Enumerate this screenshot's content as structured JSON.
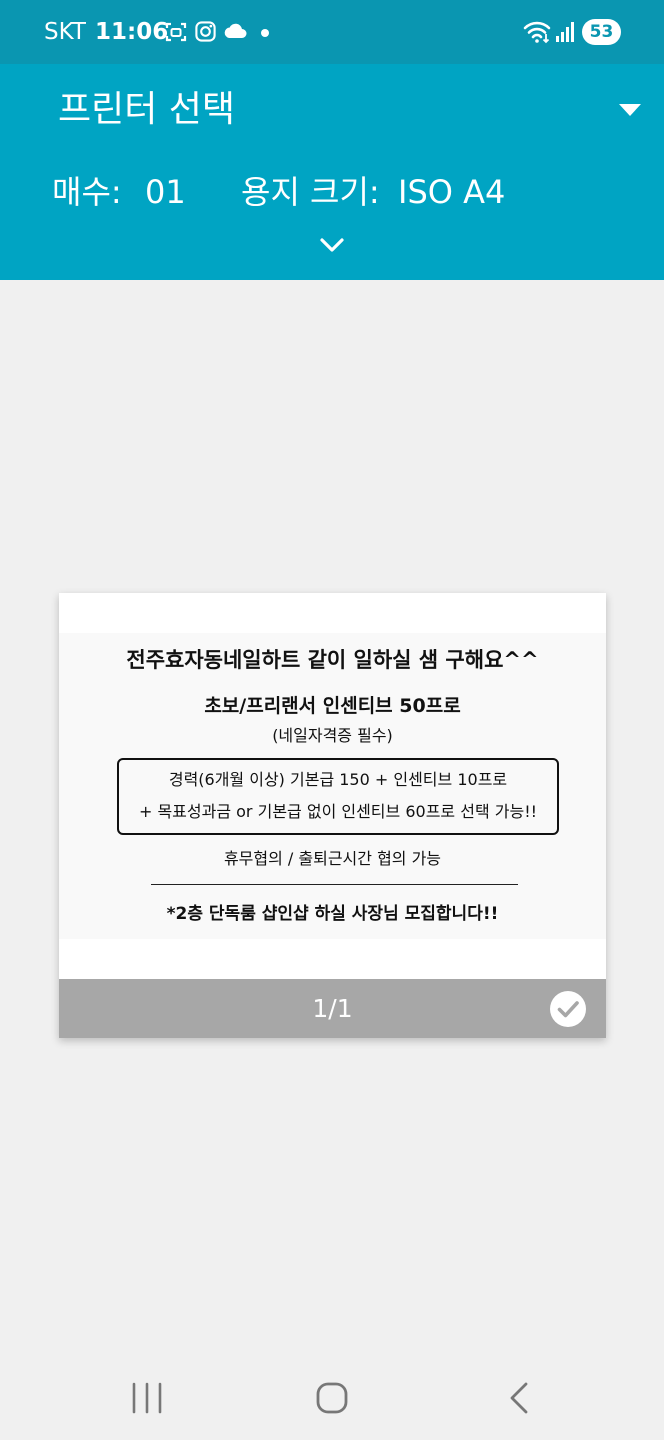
{
  "status_bar": {
    "carrier": "SKT",
    "time": "11:06",
    "battery": "53",
    "icons": [
      "screenshot-icon",
      "instagram-icon",
      "cloud-icon",
      "notification-dot",
      "wifi-icon",
      "signal-icon",
      "battery-icon"
    ]
  },
  "header": {
    "printer_title": "프린터 선택",
    "copies_label": "매수:",
    "copies_value": "01",
    "paper_size_label": "용지 크기:",
    "paper_size_value": "ISO A4"
  },
  "preview": {
    "page_counter": "1/1",
    "selected": true,
    "document": {
      "title": "전주효자동네일하트 같이 일하실 샘 구해요^^",
      "subtitle": "초보/프리랜서 인센티브 50프로",
      "note": "(네일자격증 필수)",
      "box_line1": "경력(6개월 이상) 기본급 150 + 인센티브 10프로",
      "box_line2": "+ 목표성과금 or 기본급 없이 인센티브 60프로 선택 가능!!",
      "hours": "휴무협의 / 출퇴근시간 협의 가능",
      "recruit": "*2층 단독룸 샵인샵 하실 사장님 모집합니다!!"
    }
  },
  "colors": {
    "status_bar": "#0a96b1",
    "header": "#00a4c3",
    "background": "#f0f0f0",
    "page_bar": "#a7a7a7"
  },
  "nav_bar": {
    "icons": [
      "recent-apps-icon",
      "home-icon",
      "back-icon"
    ]
  }
}
